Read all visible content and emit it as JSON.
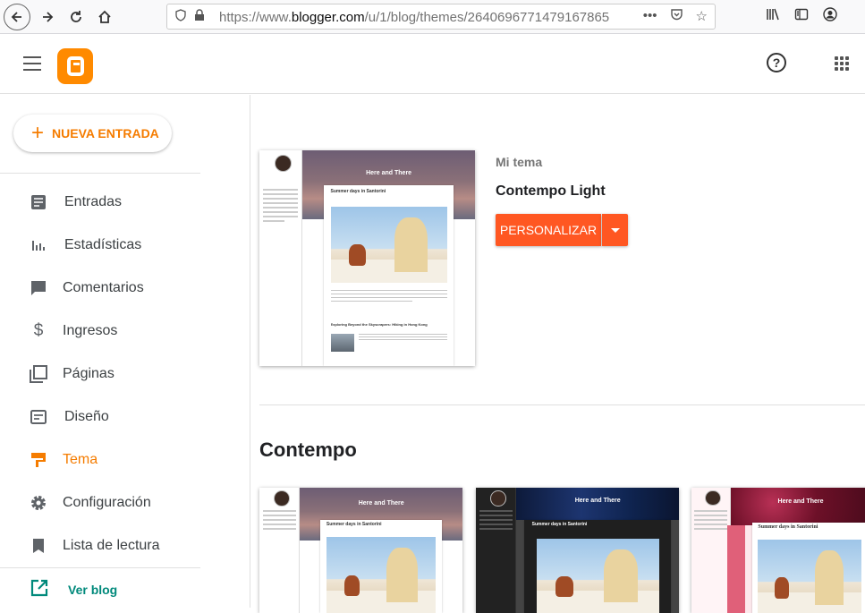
{
  "browser": {
    "url_prefix": "https://www.",
    "url_domain": "blogger.com",
    "url_path": "/u/1/blog/themes/2640696771479167865",
    "icons": [
      "back-icon",
      "forward-icon",
      "reload-icon",
      "home-icon",
      "shield-icon",
      "lock-icon",
      "more-icon",
      "pocket-icon",
      "star-icon",
      "library-icon",
      "sidebar-icon",
      "account-icon"
    ]
  },
  "header": {
    "help_label": "?"
  },
  "sidebar": {
    "new_post_label": "NUEVA ENTRADA",
    "items": [
      {
        "label": "Entradas",
        "icon": "posts-icon"
      },
      {
        "label": "Estadísticas",
        "icon": "stats-icon"
      },
      {
        "label": "Comentarios",
        "icon": "comments-icon"
      },
      {
        "label": "Ingresos",
        "icon": "earnings-icon"
      },
      {
        "label": "Páginas",
        "icon": "pages-icon"
      },
      {
        "label": "Diseño",
        "icon": "layout-icon"
      },
      {
        "label": "Tema",
        "icon": "theme-icon"
      },
      {
        "label": "Configuración",
        "icon": "settings-icon"
      },
      {
        "label": "Lista de lectura",
        "icon": "reading-list-icon"
      }
    ],
    "view_blog_label": "Ver blog",
    "active_item": "Tema"
  },
  "main": {
    "my_theme_label": "Mi tema",
    "theme_name": "Contempo Light",
    "customize_label": "PERSONALIZAR",
    "section_title": "Contempo",
    "preview": {
      "blog_title": "Here and There",
      "post_title": "Summer days in Santorini",
      "post2_title": "Exploring Beyond the Skyscrapers: Hiking in Hong Kong"
    }
  },
  "colors": {
    "accent": "#f57c00",
    "customize_button": "#ff5722",
    "view_blog": "#00897b"
  }
}
